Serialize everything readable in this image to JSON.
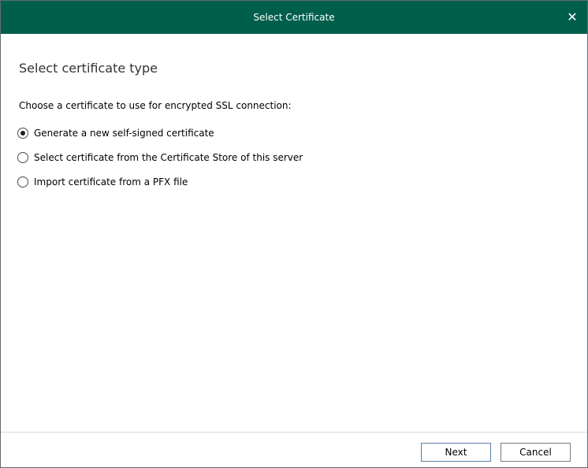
{
  "window": {
    "title": "Select Certificate",
    "close_glyph": "✕",
    "close_icon": "close-icon"
  },
  "page": {
    "heading": "Select certificate type",
    "prompt": "Choose a certificate to use for encrypted SSL connection:"
  },
  "options": [
    {
      "label": "Generate a new self-signed certificate",
      "selected": true
    },
    {
      "label": "Select certificate from the Certificate Store of this server",
      "selected": false
    },
    {
      "label": "Import certificate from a PFX file",
      "selected": false
    }
  ],
  "buttons": {
    "next": "Next",
    "cancel": "Cancel"
  },
  "colors": {
    "titlebar": "#005f4b",
    "title_text": "#ffffff"
  }
}
